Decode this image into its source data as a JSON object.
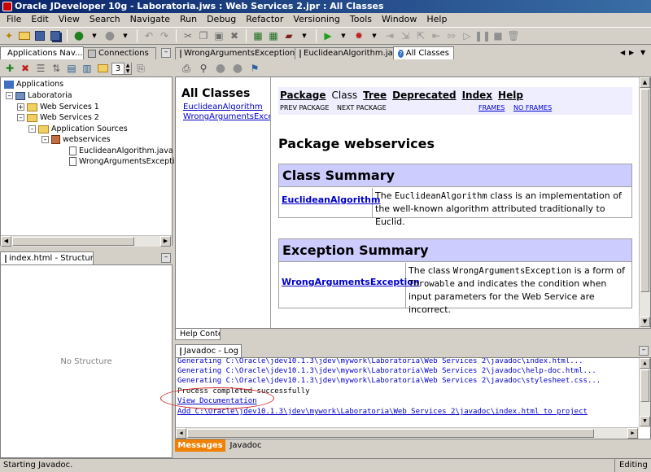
{
  "window": {
    "title": "Oracle JDeveloper 10g - Laboratoria.jws : Web Services 2.jpr : All Classes"
  },
  "menu": [
    {
      "label": "File"
    },
    {
      "label": "Edit"
    },
    {
      "label": "View"
    },
    {
      "label": "Search"
    },
    {
      "label": "Navigate"
    },
    {
      "label": "Run"
    },
    {
      "label": "Debug"
    },
    {
      "label": "Refactor"
    },
    {
      "label": "Versioning"
    },
    {
      "label": "Tools"
    },
    {
      "label": "Window"
    },
    {
      "label": "Help"
    }
  ],
  "navigator": {
    "tabs": [
      {
        "label": "Applications Nav..."
      },
      {
        "label": "Connections"
      }
    ],
    "spinner_value": "3",
    "tree": [
      {
        "label": "Applications",
        "icon": "applications-icon"
      },
      {
        "label": "Laboratoria",
        "icon": "workspace-icon"
      },
      {
        "label": "Web Services 1",
        "icon": "project-icon"
      },
      {
        "label": "Web Services 2",
        "icon": "project-icon"
      },
      {
        "label": "Application Sources",
        "icon": "folder-icon"
      },
      {
        "label": "webservices",
        "icon": "package-icon"
      },
      {
        "label": "EuclideanAlgorithm.java",
        "icon": "java-file-icon"
      },
      {
        "label": "WrongArgumentsException.java",
        "icon": "java-file-icon"
      }
    ]
  },
  "structure": {
    "tab_label": "index.html - Structure",
    "empty_text": "No Structure"
  },
  "editor": {
    "tabs": [
      {
        "label": "WrongArgumentsException.java"
      },
      {
        "label": "EuclideanAlgorithm.java"
      },
      {
        "label": "All Classes"
      }
    ],
    "frame_left": {
      "heading": "All Classes",
      "links": [
        "EuclideanAlgorithm",
        "WrongArgumentsException"
      ]
    },
    "navbar": {
      "items": [
        "Package",
        "Class",
        "Tree",
        "Deprecated",
        "Index",
        "Help"
      ],
      "prev": "PREV PACKAGE",
      "next": "NEXT PACKAGE",
      "frames": "FRAMES",
      "noframes": "NO FRAMES"
    },
    "package_title": "Package webservices",
    "class_summary": {
      "heading": "Class Summary",
      "name": "EuclideanAlgorithm",
      "desc_pre": "The ",
      "desc_code": "EuclideanAlgorithm",
      "desc_post": " class is an implementation of the well-known algorithm attributed traditionally to Euclid."
    },
    "exception_summary": {
      "heading": "Exception Summary",
      "name": "WrongArgumentsException",
      "desc_pre": "The class ",
      "desc_code": "WrongArgumentsException",
      "desc_mid": " is a form of ",
      "desc_code2": "Throwable",
      "desc_post": " and indicates the condition when input parameters for the Web Service are incorrect."
    },
    "bottom_tab": "Help Content"
  },
  "log": {
    "tab_label": "Javadoc - Log",
    "lines": [
      {
        "text": "Generating C:\\Oracle\\jdev10.1.3\\jdev\\mywork\\Laboratoria\\Web Services 2\\javadoc\\index.html...",
        "kind": "info"
      },
      {
        "text": "Generating C:\\Oracle\\jdev10.1.3\\jdev\\mywork\\Laboratoria\\Web Services 2\\javadoc\\help-doc.html...",
        "kind": "info"
      },
      {
        "text": "Generating C:\\Oracle\\jdev10.1.3\\jdev\\mywork\\Laboratoria\\Web Services 2\\javadoc\\stylesheet.css...",
        "kind": "info"
      },
      {
        "text": "Process completed successfully",
        "kind": "plain"
      },
      {
        "text": "View Documentation",
        "kind": "link"
      },
      {
        "text": "Add C:\\Oracle\\jdev10.1.3\\jdev\\mywork\\Laboratoria\\Web Services 2\\javadoc\\index.html to project",
        "kind": "link"
      }
    ],
    "bottom_tabs": [
      {
        "label": "Messages"
      },
      {
        "label": "Javadoc"
      }
    ]
  },
  "status": {
    "left": "Starting Javadoc.",
    "right": "Editing"
  },
  "colors": {
    "title_start": "#0a246a",
    "title_end": "#3a6ea5",
    "messages_tab": "#f08000",
    "table_header": "#ccccff",
    "link": "#0000cc",
    "annotation_circle": "#d02020"
  }
}
